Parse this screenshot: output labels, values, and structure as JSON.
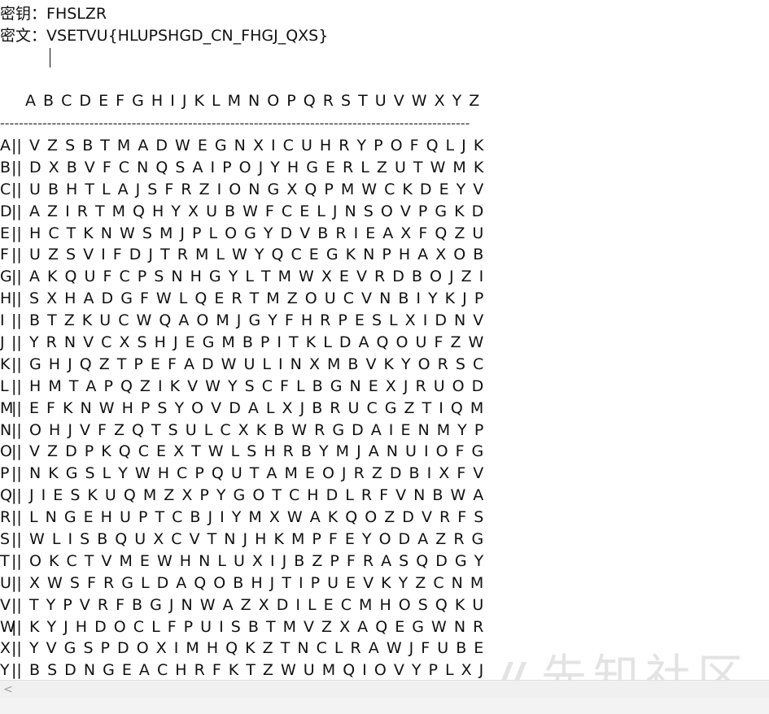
{
  "key_label": "密钥：",
  "key_value": "FHSLZR",
  "cipher_label": "密文：",
  "cipher_value": "VSETVU{HLUPSHGD_CN_FHGJ_QXS}",
  "header_row": "A B C D E F G H I J K L M N O P Q R S T U V W X Y Z",
  "separator": "----------------------------------------------------------------------------------------------------",
  "bar": "||",
  "rows": [
    {
      "letter": "A",
      "seq": "V Z S B T M A D W E G N X I C U H R Y P O F Q L J K"
    },
    {
      "letter": "B",
      "seq": "D X B V F C N Q S A I P O J Y H G E R L Z U T W M K"
    },
    {
      "letter": "C",
      "seq": "U B H T L A J S F R Z I O N G X Q P M W C K D E Y V"
    },
    {
      "letter": "D",
      "seq": "A Z I R T M Q H Y X U B W F C E L J N S O V P G K D"
    },
    {
      "letter": "E",
      "seq": "H C T K N W S M J P L O G Y D V B R I E A X F Q Z U"
    },
    {
      "letter": "F",
      "seq": "U Z S V I F D J T R M L W Y Q C E G K N P H A X O B"
    },
    {
      "letter": "G",
      "seq": "A K Q U F C P S N H G Y L T M W X E V R D B O J Z I"
    },
    {
      "letter": "H",
      "seq": "S X H A D G F W L Q E R T M Z O U C V N B I Y K J P"
    },
    {
      "letter": "I",
      "seq": "B T Z K U C W Q A O M J G Y F H R P E S L X I D N V"
    },
    {
      "letter": "J",
      "seq": "Y R N V C X S H J E G M B P I T K L D A Q O U F Z W"
    },
    {
      "letter": "K",
      "seq": "G H J Q Z T P E F A D W U L I N X M B V K Y O R S C"
    },
    {
      "letter": "L",
      "seq": "H M T A P Q Z I K V W Y S C F L B G N E X J R U O D"
    },
    {
      "letter": "M",
      "seq": "E F K N W H P S Y O V D A L X J B R U C G Z T I Q M"
    },
    {
      "letter": "N",
      "seq": "O H J V F Z Q T S U L C X K B W R G D A I E N M Y P"
    },
    {
      "letter": "O",
      "seq": "V Z D P K Q C E X T W L S H R B Y M J A N U I O F G"
    },
    {
      "letter": "P",
      "seq": "N K G S L Y W H C P Q U T A M E O J R Z D B I X F V"
    },
    {
      "letter": "Q",
      "seq": "J I E S K U Q M Z X P Y G O T C H D L R F V N B W A"
    },
    {
      "letter": "R",
      "seq": "L N G E H U P T C B J I Y M X W A K Q O Z D V R F S"
    },
    {
      "letter": "S",
      "seq": "W L I S B Q U X C V T N J H K M P F E Y O D A Z R G"
    },
    {
      "letter": "T",
      "seq": "O K C T V M E W H N L U X I J B Z P F R A S Q D G Y"
    },
    {
      "letter": "U",
      "seq": "X W S F R G L D A Q O B H J T I P U E V K Y Z C N M"
    },
    {
      "letter": "V",
      "seq": "T Y P V R F B G J N W A Z X D I L E C M H O S Q K U"
    },
    {
      "letter": "W",
      "seq": "K Y J H D O C L F P U I S B T M V Z X A Q E G W N R"
    },
    {
      "letter": "X",
      "seq": "Y V G S P D O X I M H Q K Z T N C L R A W J F U B E"
    },
    {
      "letter": "Y",
      "seq": "B S D N G E A C H R F K T Z W U M Q I O V Y P L X J"
    }
  ],
  "watermark_text": "先知社区",
  "scroll_left_glyph": "<"
}
